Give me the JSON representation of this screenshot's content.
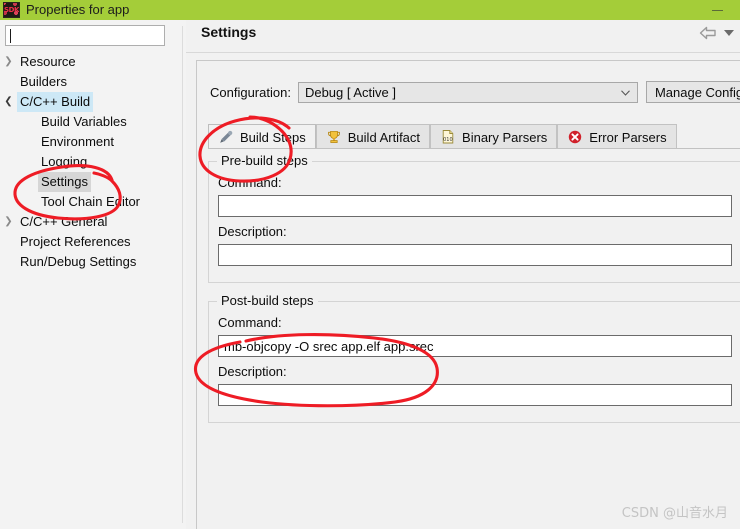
{
  "window": {
    "title": "Properties for app",
    "app_icon": "sdk-icon",
    "minimize_label": "—",
    "titlebar_color": "#a4cd39"
  },
  "sidebar": {
    "filter": {
      "value": "",
      "placeholder": ""
    },
    "items": [
      {
        "label": "Resource",
        "state": "collapsed",
        "indent": 1,
        "selected": "none"
      },
      {
        "label": "Builders",
        "state": "leaf",
        "indent": 1,
        "selected": "none"
      },
      {
        "label": "C/C++ Build",
        "state": "expanded",
        "indent": 1,
        "selected": "focus"
      },
      {
        "label": "Build Variables",
        "state": "leaf",
        "indent": 2,
        "selected": "none"
      },
      {
        "label": "Environment",
        "state": "leaf",
        "indent": 2,
        "selected": "none"
      },
      {
        "label": "Logging",
        "state": "leaf",
        "indent": 2,
        "selected": "none"
      },
      {
        "label": "Settings",
        "state": "leaf",
        "indent": 2,
        "selected": "gray"
      },
      {
        "label": "Tool Chain Editor",
        "state": "leaf",
        "indent": 2,
        "selected": "none"
      },
      {
        "label": "C/C++ General",
        "state": "collapsed",
        "indent": 1,
        "selected": "none"
      },
      {
        "label": "Project References",
        "state": "leaf",
        "indent": 1,
        "selected": "none"
      },
      {
        "label": "Run/Debug Settings",
        "state": "leaf",
        "indent": 1,
        "selected": "none"
      }
    ]
  },
  "page": {
    "title": "Settings",
    "back_icon": "back-arrow-icon",
    "menu_icon": "chevron-down-icon"
  },
  "configuration": {
    "label": "Configuration:",
    "selected": "Debug  [ Active ]",
    "dropdown_icon": "chevron-down-icon",
    "manage_button": "Manage Configu"
  },
  "tabs": [
    {
      "label": "Build Steps",
      "icon": "build-steps-icon",
      "active": true
    },
    {
      "label": "Build Artifact",
      "icon": "trophy-icon",
      "active": false
    },
    {
      "label": "Binary Parsers",
      "icon": "binary-file-icon",
      "active": false
    },
    {
      "label": "Error Parsers",
      "icon": "error-circle-icon",
      "active": false
    }
  ],
  "prebuild": {
    "legend": "Pre-build steps",
    "command_label": "Command:",
    "command_value": "",
    "description_label": "Description:",
    "description_value": ""
  },
  "postbuild": {
    "legend": "Post-build steps",
    "command_label": "Command:",
    "command_value": "mb-objcopy -O srec app.elf app.srec",
    "description_label": "Description:",
    "description_value": ""
  },
  "annotations": {
    "color": "#ee1c25",
    "circles": [
      "settings-tree-item",
      "build-steps-tab",
      "post-build-command"
    ]
  },
  "watermark": "CSDN @山音水月"
}
